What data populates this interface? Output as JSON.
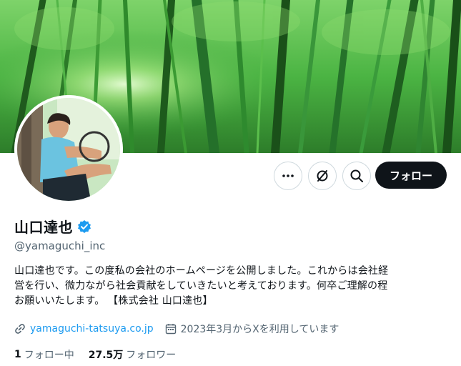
{
  "profile": {
    "display_name": "山口達也",
    "handle": "@yamaguchi_inc",
    "bio_lines": [
      "山口達也です。この度私の会社のホームページを公開しました。これからは会社経",
      "営を行い、微力ながら社会貢献をしていきたいと考えております。何卒ご理解の程",
      "お願いいたします。 【株式会社 山口達也】"
    ],
    "website": "yamaguchi-tatsuya.co.jp",
    "joined": "2023年3月からXを利用しています",
    "following_count": "1",
    "following_label": "フォロー中",
    "followers_count": "27.5万",
    "followers_label": "フォロワー"
  },
  "actions": {
    "follow_label": "フォロー",
    "more_icon": "more-dots-icon",
    "grok_icon": "grok-icon",
    "search_icon": "search-icon"
  },
  "colors": {
    "accent": "#1d9bf0",
    "follow_bg": "#0f1419",
    "muted": "#536471",
    "verified": "#1d9bf0"
  }
}
